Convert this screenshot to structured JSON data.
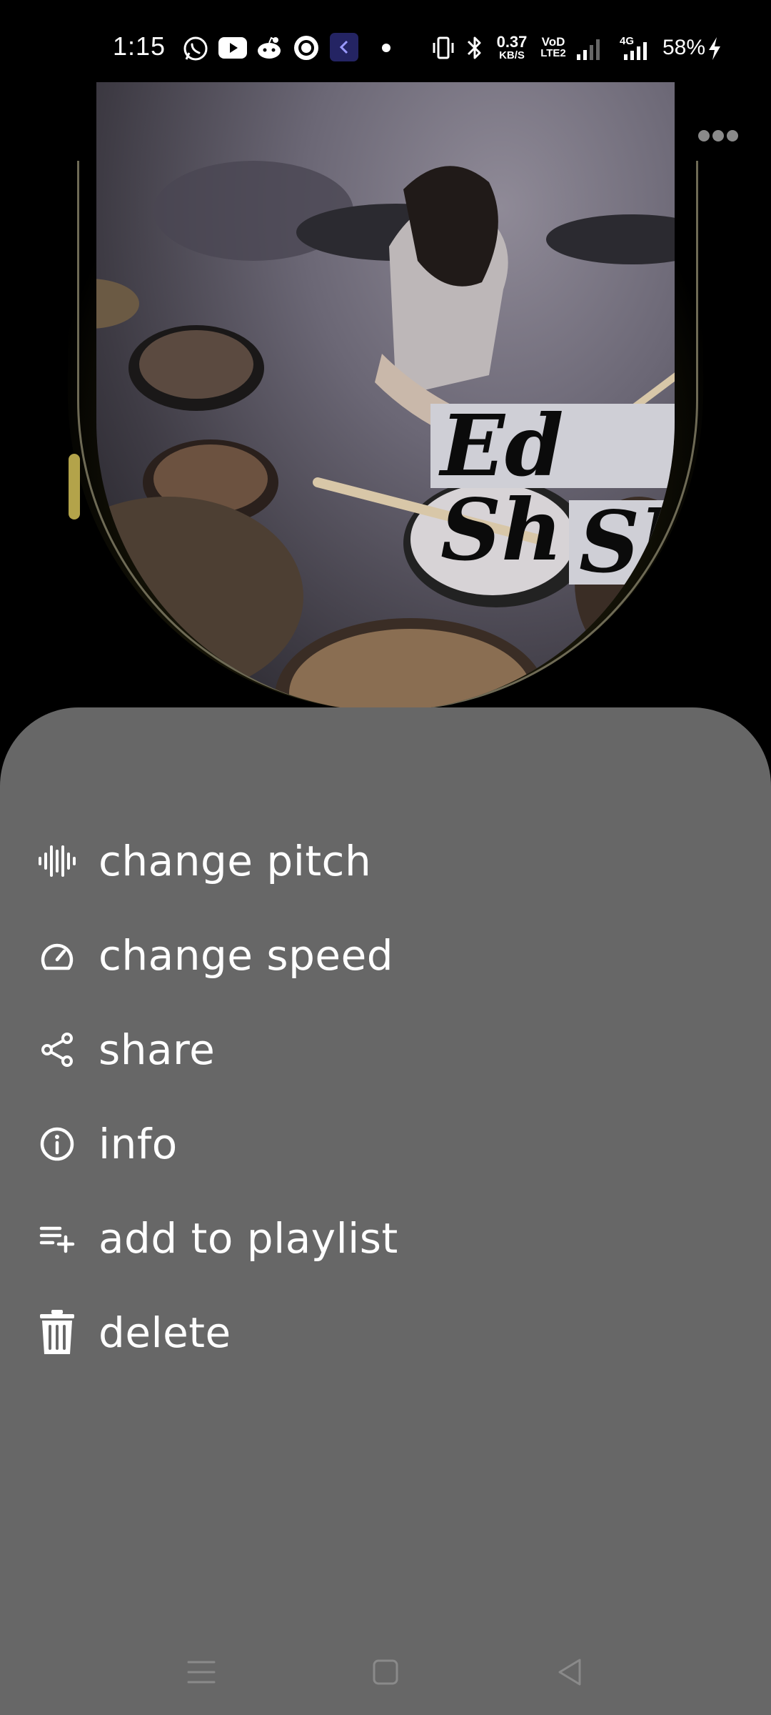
{
  "status_bar": {
    "time": "1:15",
    "icons": [
      "whatsapp-icon",
      "youtube-icon",
      "reddit-icon",
      "circle-app-icon",
      "app-back-icon",
      "dot-icon",
      "vibrate-icon",
      "bluetooth-icon",
      "vod-lte-icon",
      "signal-icon",
      "signal-4g-icon",
      "charging-icon"
    ],
    "net_speed_value": "0.37",
    "net_speed_unit": "KB/S",
    "vod_label": "VoD",
    "lte_label": "LTE2",
    "network_type": "4G",
    "battery": "58%"
  },
  "album_art": {
    "overlay_line1": "Ed Sh",
    "overlay_line2": "Sh",
    "progress_fraction": 0.05
  },
  "more_button": {
    "icon": "more-horizontal-icon"
  },
  "menu": {
    "items": [
      {
        "label": "change pitch",
        "icon": "waveform-icon"
      },
      {
        "label": "change speed",
        "icon": "speedometer-icon"
      },
      {
        "label": "share",
        "icon": "share-icon"
      },
      {
        "label": "info",
        "icon": "info-icon"
      },
      {
        "label": "add to playlist",
        "icon": "playlist-add-icon"
      },
      {
        "label": "delete",
        "icon": "trash-icon"
      }
    ]
  },
  "nav_bar": {
    "buttons": [
      "menu-icon",
      "home-icon",
      "back-icon"
    ]
  },
  "colors": {
    "sheet_bg": "#676767",
    "background": "#000000",
    "accent_gold": "#b3a34a",
    "text": "#ffffff"
  }
}
